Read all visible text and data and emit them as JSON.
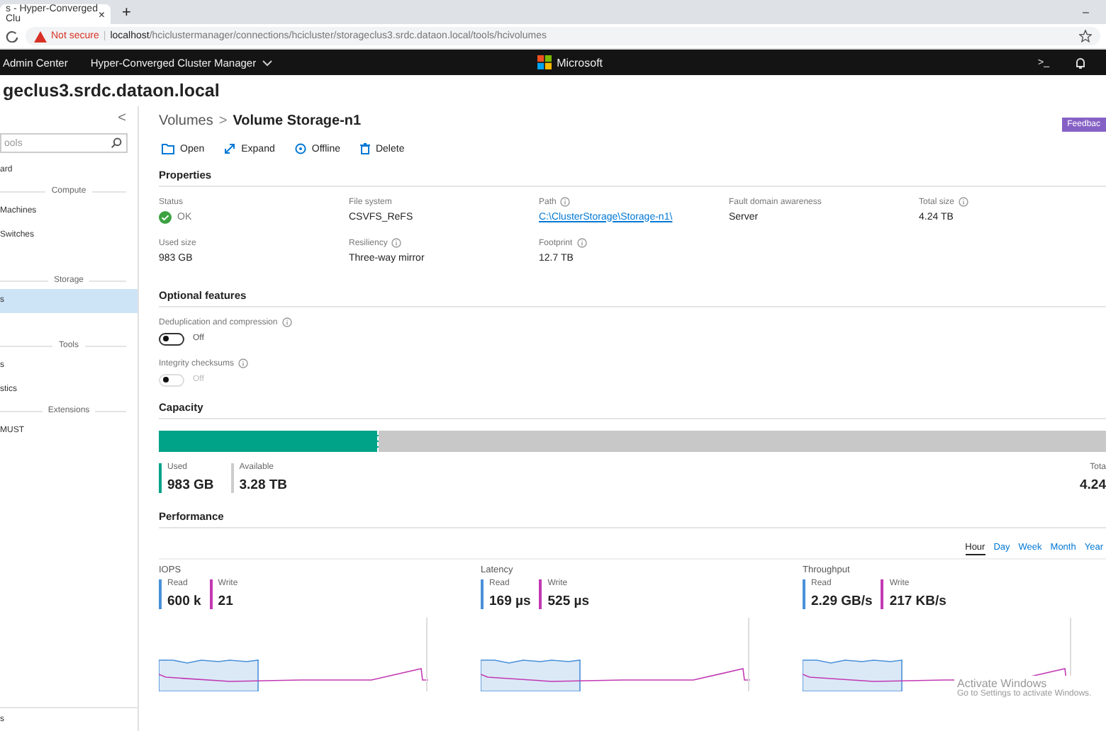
{
  "browser": {
    "tab_title": "s - Hyper-Converged Clu",
    "tab_close": "×",
    "new_tab": "+",
    "minimize": "–",
    "not_secure": "Not secure",
    "divider": "|",
    "url_host": "localhost",
    "url_path": "/hciclustermanager/connections/hcicluster/storageclus3.srdc.dataon.local/tools/hcivolumes"
  },
  "header": {
    "app": "Admin Center",
    "tool": "Hyper-Converged Cluster Manager",
    "brand": "Microsoft",
    "terminal": ">_"
  },
  "cluster_title": "geclus3.srdc.dataon.local",
  "sidebar": {
    "collapse": "<",
    "search": {
      "placeholder": "ools"
    },
    "items": [
      {
        "kind": "item",
        "label": "ard",
        "selected": false
      },
      {
        "kind": "group",
        "label": "Compute"
      },
      {
        "kind": "item",
        "label": "Machines",
        "selected": false
      },
      {
        "kind": "item",
        "label": "Switches",
        "selected": false
      },
      {
        "kind": "spacer"
      },
      {
        "kind": "group",
        "label": "Storage"
      },
      {
        "kind": "item",
        "label": "s",
        "selected": true
      },
      {
        "kind": "spacer"
      },
      {
        "kind": "group",
        "label": "Tools"
      },
      {
        "kind": "item",
        "label": "s",
        "selected": false
      },
      {
        "kind": "item",
        "label": "stics",
        "selected": false
      },
      {
        "kind": "group",
        "label": "Extensions"
      },
      {
        "kind": "item",
        "label": "MUST",
        "selected": false
      }
    ],
    "footer": "s"
  },
  "breadcrumb": {
    "parent": "Volumes",
    "separator": ">",
    "current": "Volume Storage-n1"
  },
  "feedback": "Feedbac",
  "toolbar": [
    {
      "kind": "open",
      "label": "Open"
    },
    {
      "kind": "expand",
      "label": "Expand"
    },
    {
      "kind": "offline",
      "label": "Offline"
    },
    {
      "kind": "delete",
      "label": "Delete"
    }
  ],
  "properties": {
    "title": "Properties",
    "fields": [
      {
        "label": "Status",
        "value": "OK",
        "kind": "status",
        "info": false
      },
      {
        "label": "File system",
        "value": "CSVFS_ReFS",
        "kind": "text",
        "info": false
      },
      {
        "label": "Path",
        "value": "C:\\ClusterStorage\\Storage-n1\\",
        "kind": "link",
        "info": true
      },
      {
        "label": "Fault domain awareness",
        "value": "Server",
        "kind": "text",
        "info": false
      },
      {
        "label": "Total size",
        "value": "4.24 TB",
        "kind": "text",
        "info": true
      },
      {
        "label": "Used size",
        "value": "983 GB",
        "kind": "text",
        "info": false
      },
      {
        "label": "Resiliency",
        "value": "Three-way mirror",
        "kind": "text",
        "info": true
      },
      {
        "label": "Footprint",
        "value": "12.7 TB",
        "kind": "text",
        "info": true
      }
    ]
  },
  "optional_features": {
    "title": "Optional features",
    "items": [
      {
        "label": "Deduplication and compression",
        "state": "Off",
        "on": false,
        "disabled": false
      },
      {
        "label": "Integrity checksums",
        "state": "Off",
        "on": false,
        "disabled": true
      }
    ]
  },
  "capacity": {
    "title": "Capacity",
    "level": 0.23,
    "used": {
      "label": "Used",
      "value": "983 GB"
    },
    "available": {
      "label": "Available",
      "value": "3.28 TB"
    },
    "total": {
      "label": "Tota",
      "value": "4.24"
    }
  },
  "performance": {
    "title": "Performance",
    "ranges": [
      {
        "label": "Hour",
        "selected": true
      },
      {
        "label": "Day",
        "selected": false
      },
      {
        "label": "Week",
        "selected": false
      },
      {
        "label": "Month",
        "selected": false
      },
      {
        "label": "Year",
        "selected": false
      }
    ],
    "metrics": [
      {
        "title": "IOPS",
        "read_label": "Read",
        "read": "600 k",
        "write_label": "Write",
        "write": "21"
      },
      {
        "title": "Latency",
        "read_label": "Read",
        "read": "169 µs",
        "write_label": "Write",
        "write": "525 µs"
      },
      {
        "title": "Throughput",
        "read_label": "Read",
        "read": "2.29 GB/s",
        "write_label": "Write",
        "write": "217 KB/s"
      }
    ]
  },
  "os_notice": {
    "title": "Activate Windows",
    "text": "Go to Settings to activate Windows."
  }
}
